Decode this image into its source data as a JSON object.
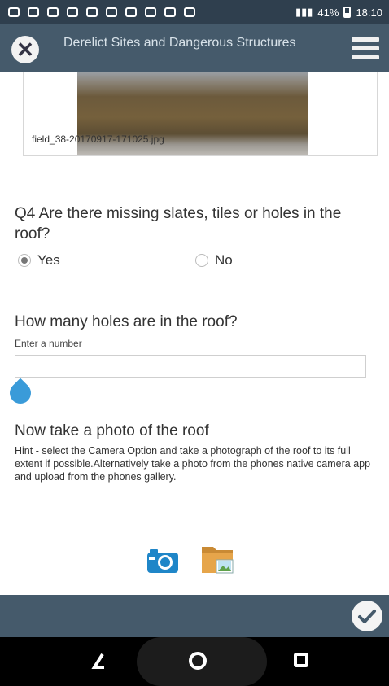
{
  "status_bar": {
    "battery": "41%",
    "time": "18:10"
  },
  "app_bar": {
    "title": "Derelict Sites and Dangerous Structures",
    "close_icon": "close-icon",
    "menu_icon": "hamburger-menu-icon"
  },
  "photo_attachment": {
    "filename": "field_38-20170917-171025.jpg"
  },
  "q4": {
    "text": "Q4 Are there missing slates, tiles or holes in the roof?",
    "options": [
      {
        "label": "Yes",
        "selected": true
      },
      {
        "label": "No",
        "selected": false
      }
    ]
  },
  "holes_question": {
    "text": "How many holes are in the roof?",
    "hint": "Enter a number",
    "value": ""
  },
  "roof_photo": {
    "text": "Now take a photo of the roof",
    "hint": "Hint - select the Camera Option and take a photograph of the roof to its full extent if possible.Alternatively take a photo from the phones native camera app and upload from the phones gallery.",
    "camera_icon": "camera-icon",
    "gallery_icon": "folder-image-icon"
  },
  "colors": {
    "app_bar": "#455a6b",
    "status_bar": "#2f3f4e",
    "accent": "#3a9bd9",
    "camera_blue": "#1f86c8",
    "folder_orange": "#e6a54a"
  }
}
